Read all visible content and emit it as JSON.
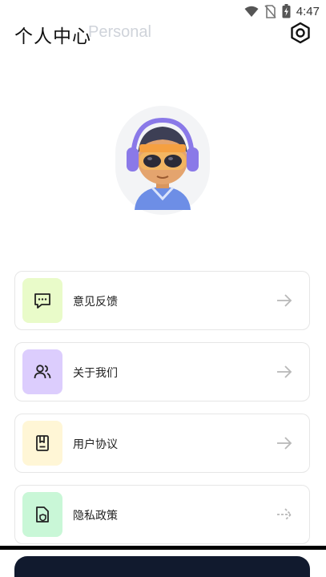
{
  "status_bar": {
    "time": "4:47"
  },
  "header": {
    "title": "个人中心",
    "subtitle": "Personal"
  },
  "menu": [
    {
      "label": "意见反馈",
      "icon": "message-icon",
      "color": "#e9fbc9"
    },
    {
      "label": "关于我们",
      "icon": "users-icon",
      "color": "#dccdfd"
    },
    {
      "label": "用户协议",
      "icon": "document-icon",
      "color": "#fff6d6"
    },
    {
      "label": "隐私政策",
      "icon": "privacy-shield-icon",
      "color": "#c9f7d7"
    }
  ]
}
